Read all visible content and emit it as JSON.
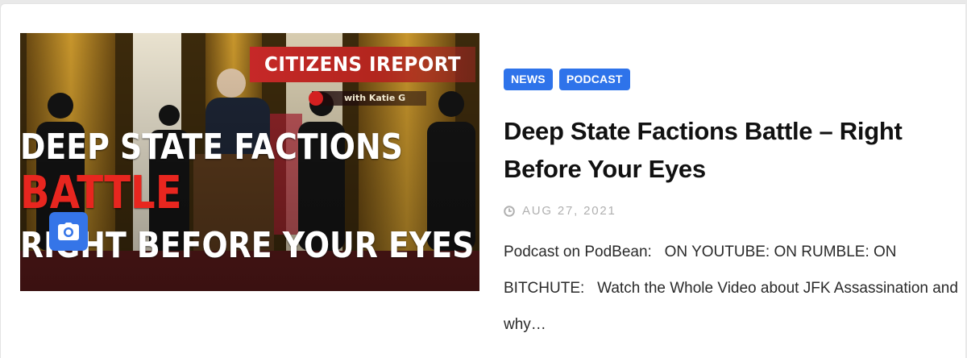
{
  "thumbnail": {
    "banner": "CITIZENS IREPORT",
    "byline": "with Katie G",
    "headline_line1": "DEEP STATE FACTIONS",
    "headline_line2": "BATTLE",
    "headline_line3": "RIGHT BEFORE YOUR EYES"
  },
  "categories": [
    "NEWS",
    "PODCAST"
  ],
  "post": {
    "title": "Deep State Factions Battle – Right Before Your Eyes",
    "date": "AUG 27, 2021",
    "excerpt": "Podcast on PodBean:   ON YOUTUBE: ON RUMBLE: ON BITCHUTE:   Watch the Whole Video about JFK Assassination and why…"
  },
  "colors": {
    "badge": "#2e73ea",
    "headline_red": "#e8261f",
    "camera_badge": "#3575e8"
  },
  "icons": {
    "camera": "camera-icon",
    "clock": "clock-icon"
  }
}
